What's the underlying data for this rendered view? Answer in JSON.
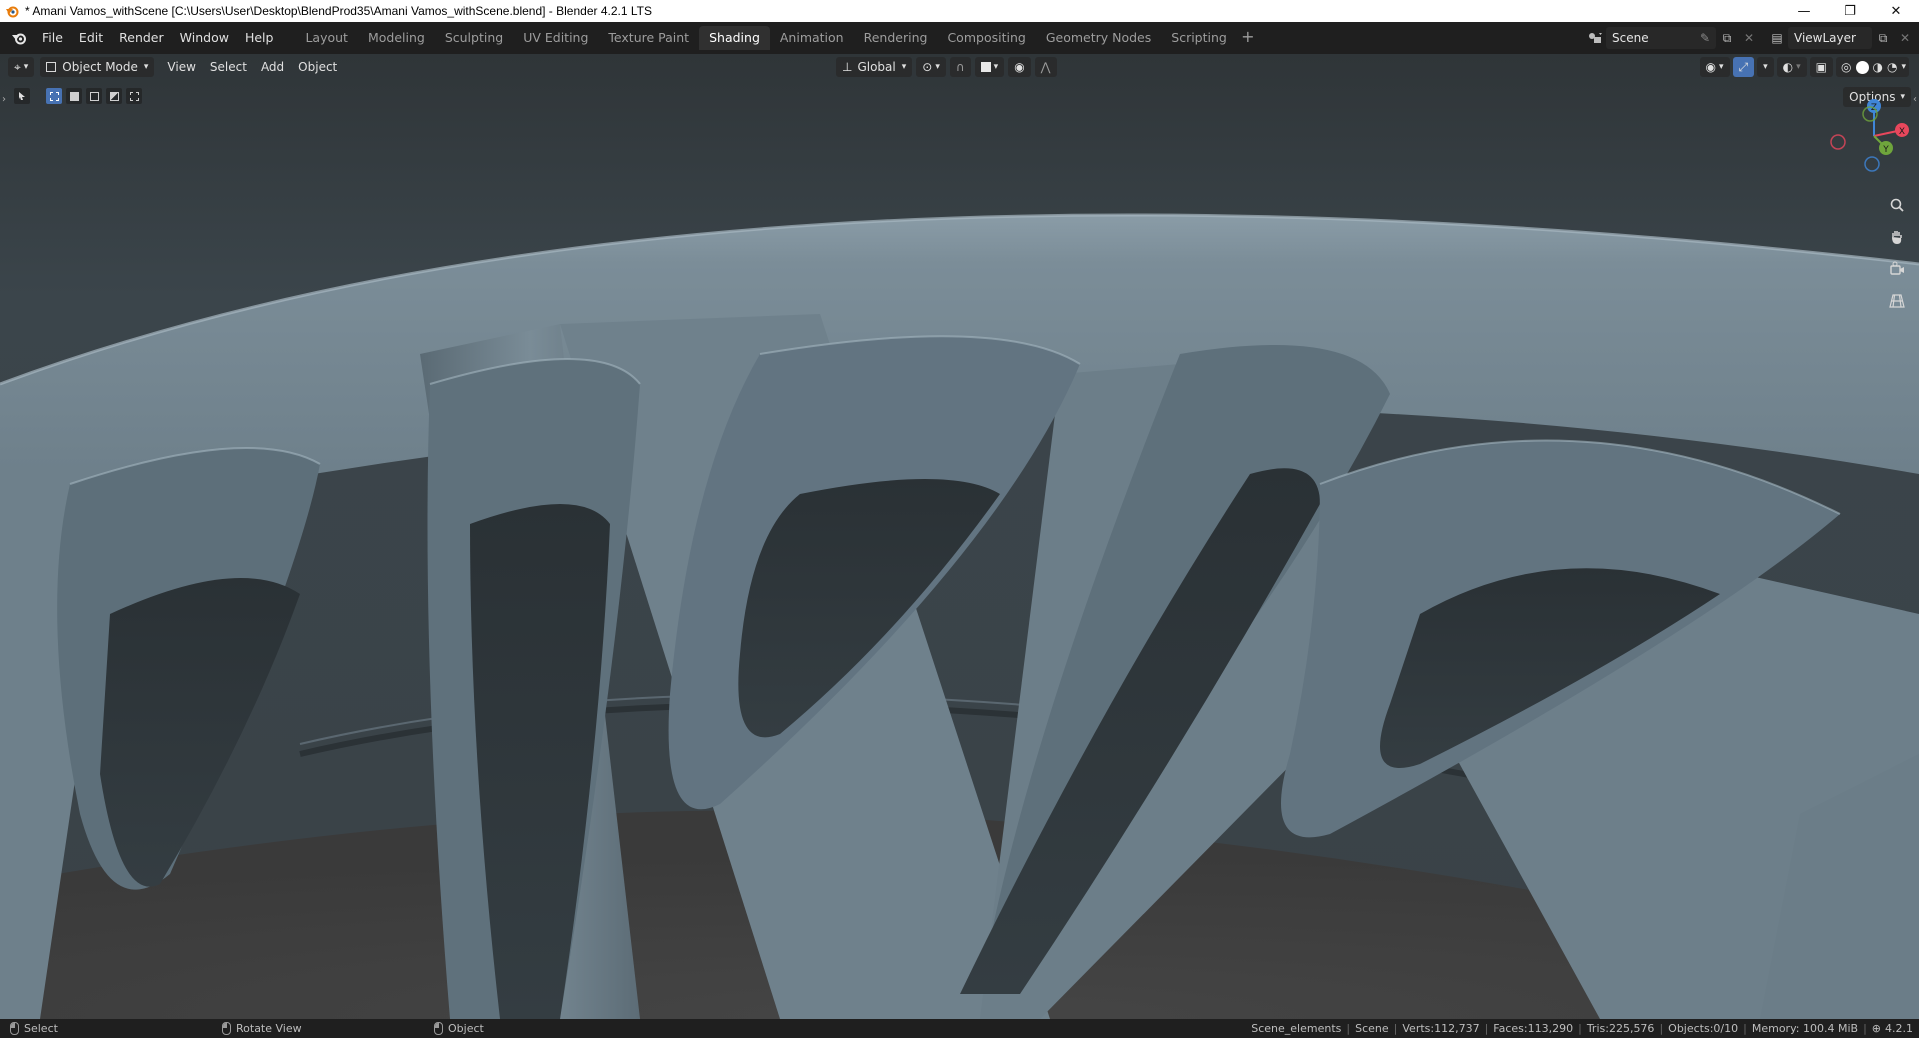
{
  "window": {
    "title": "* Amani Vamos_withScene [C:\\Users\\User\\Desktop\\BlendProd35\\Amani Vamos_withScene.blend] - Blender 4.2.1 LTS",
    "controls": [
      "—",
      "❐",
      "✕"
    ]
  },
  "topbar": {
    "menu": [
      "File",
      "Edit",
      "Render",
      "Window",
      "Help"
    ],
    "workspaces": [
      "Layout",
      "Modeling",
      "Sculpting",
      "UV Editing",
      "Texture Paint",
      "Shading",
      "Animation",
      "Rendering",
      "Compositing",
      "Geometry Nodes",
      "Scripting"
    ],
    "active_workspace": "Shading",
    "add_tab": "+",
    "scene": "Scene",
    "view_layer": "ViewLayer"
  },
  "viewport_header": {
    "mode": "Object Mode",
    "menus": [
      "View",
      "Select",
      "Add",
      "Object"
    ],
    "transform_orientation": "Global",
    "options": "Options"
  },
  "gizmo": {
    "x": "X",
    "y": "Y",
    "z": "Z"
  },
  "statusbar": {
    "hints": [
      {
        "label": "Select"
      },
      {
        "label": "Rotate View"
      },
      {
        "label": "Object"
      }
    ],
    "stats": [
      "Scene_elements",
      "Scene",
      "Verts:112,737",
      "Faces:113,290",
      "Tris:225,576",
      "Objects:0/10",
      "Memory: 100.4 MiB"
    ],
    "version": "4.2.1"
  },
  "colors": {
    "accent_blue": "#4772b3",
    "axis_x": "#e8475c",
    "axis_y": "#6fa53c",
    "axis_z": "#3f86d8",
    "mesh": "#6b7d88"
  }
}
